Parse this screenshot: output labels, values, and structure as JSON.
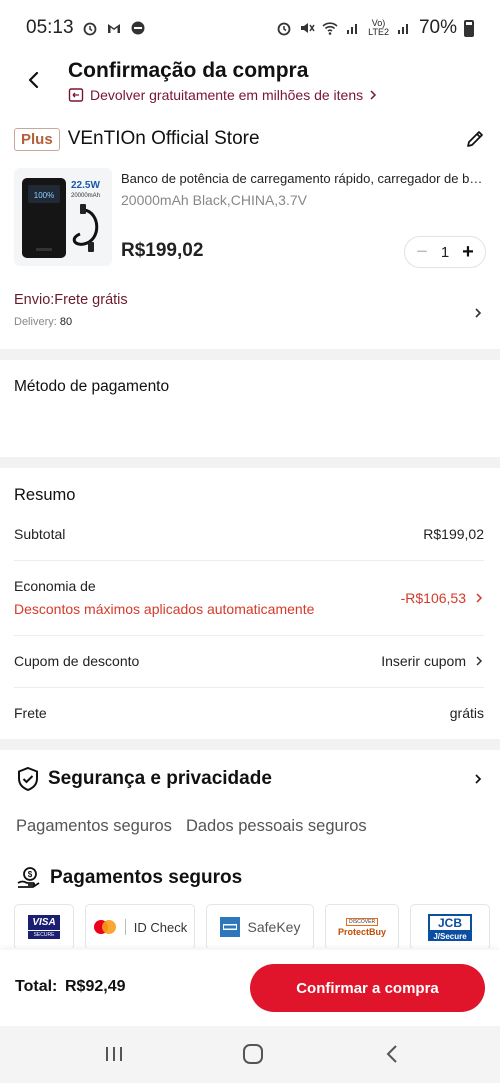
{
  "status_bar": {
    "time": "05:13",
    "battery": "70%",
    "network": "LTE2",
    "volte": "Vo)"
  },
  "header": {
    "title": "Confirmação da compra",
    "return_note": "Devolver gratuitamente em milhões de itens"
  },
  "store": {
    "badge": "Plus",
    "name": "VEnTIOn Official Store"
  },
  "product": {
    "title": "Banco de potência de carregamento rápido, carregador de ba...",
    "variant": "20000mAh Black,CHINA,3.7V",
    "price": "R$199,02",
    "quantity": "1",
    "image_label_power": "22.5W",
    "image_label_capacity": "20000mAh"
  },
  "shipping": {
    "label": "Envio:Frete grátis",
    "delivery_label": "Delivery:",
    "delivery_value": "80"
  },
  "payment_method": {
    "title": "Método de pagamento"
  },
  "summary": {
    "title": "Resumo",
    "subtotal_label": "Subtotal",
    "subtotal_value": "R$199,02",
    "savings_label": "Economia de",
    "savings_note": "Descontos máximos aplicados automaticamente",
    "savings_value": "-R$106,53",
    "coupon_label": "Cupom de desconto",
    "coupon_action": "Inserir cupom",
    "shipping_label": "Frete",
    "shipping_value": "grátis"
  },
  "security": {
    "title": "Segurança e privacidade",
    "tabs": [
      "Pagamentos seguros",
      "Dados pessoais seguros"
    ]
  },
  "secure_payments": {
    "title": "Pagamentos seguros",
    "badges": [
      {
        "name": "visa-secure",
        "line1": "VISA",
        "line2": "SECURE"
      },
      {
        "name": "mastercard-id-check",
        "text": "ID Check"
      },
      {
        "name": "amex-safekey",
        "text": "SafeKey"
      },
      {
        "name": "discover-protectbuy",
        "line1": "DISCOVER",
        "line2": "ProtectBuy"
      },
      {
        "name": "jcb-jsecure",
        "line1": "JCB",
        "line2": "J/Secure"
      }
    ]
  },
  "footer": {
    "total_label": "Total:",
    "total_value": "R$92,49",
    "confirm_label": "Confirmar a compra"
  },
  "colors": {
    "accent": "#e0142b",
    "discount": "#d43a2a",
    "shipping": "#6b1b2e"
  }
}
